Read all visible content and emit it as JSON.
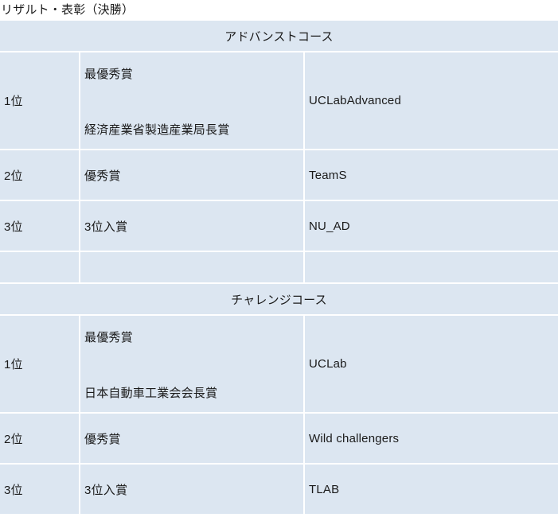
{
  "document": {
    "title": "リザルト・表彰（決勝）"
  },
  "theme": {
    "table_background": "#dce6f1",
    "gridline_color": "#ffffff",
    "text_color": "#1a1a1a",
    "page_background": "#ffffff"
  },
  "table": {
    "columns": [
      "rank",
      "award",
      "team"
    ],
    "sections": [
      {
        "header": "アドバンストコース",
        "rows": [
          {
            "rank": "1位",
            "award_lines": [
              "最優秀賞",
              "経済産業省製造産業局長賞"
            ],
            "team": "UCLabAdvanced"
          },
          {
            "rank": "2位",
            "award_lines": [
              "優秀賞"
            ],
            "team": "TeamS"
          },
          {
            "rank": "3位",
            "award_lines": [
              "3位入賞"
            ],
            "team": "NU_AD"
          }
        ]
      },
      {
        "header": "チャレンジコース",
        "rows": [
          {
            "rank": "1位",
            "award_lines": [
              "最優秀賞",
              "日本自動車工業会会長賞"
            ],
            "team": "UCLab"
          },
          {
            "rank": "2位",
            "award_lines": [
              "優秀賞"
            ],
            "team": "Wild challengers"
          },
          {
            "rank": "3位",
            "award_lines": [
              "3位入賞"
            ],
            "team": "TLAB"
          }
        ]
      }
    ]
  }
}
